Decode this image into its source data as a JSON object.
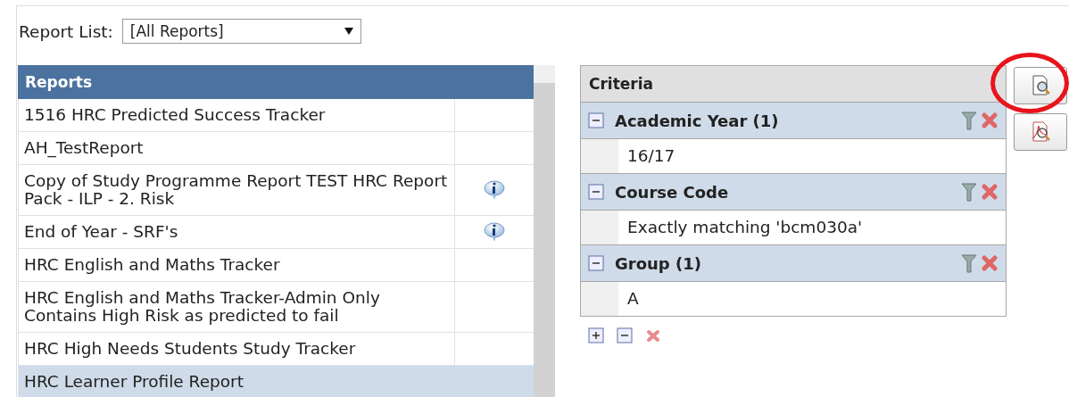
{
  "report_list": {
    "label": "Report List:",
    "value": "[All Reports]"
  },
  "reports": {
    "title": "Reports",
    "rows": [
      {
        "name": "1516 HRC Predicted Success Tracker",
        "info": false,
        "selected": false
      },
      {
        "name": "AH_TestReport",
        "info": false,
        "selected": false
      },
      {
        "name": "Copy of Study Programme Report TEST HRC Report Pack - ILP - 2. Risk",
        "info": true,
        "selected": false
      },
      {
        "name": "End of Year - SRF's",
        "info": true,
        "selected": false
      },
      {
        "name": "HRC English and Maths Tracker",
        "info": false,
        "selected": false
      },
      {
        "name": "HRC English and Maths Tracker-Admin Only Contains High Risk as predicted to fail",
        "info": false,
        "selected": false
      },
      {
        "name": "HRC High Needs Students Study Tracker",
        "info": false,
        "selected": false
      },
      {
        "name": "HRC Learner Profile Report",
        "info": false,
        "selected": true
      }
    ]
  },
  "criteria": {
    "title": "Criteria",
    "items": [
      {
        "title": "Academic Year (1)",
        "expanded": true,
        "value": "16/17"
      },
      {
        "title": "Course Code",
        "expanded": true,
        "value": "Exactly matching 'bcm030a'"
      },
      {
        "title": "Group (1)",
        "expanded": true,
        "value": "A"
      }
    ]
  },
  "side_buttons": [
    {
      "kind": "preview",
      "highlighted": true
    },
    {
      "kind": "pdf",
      "highlighted": false
    }
  ]
}
